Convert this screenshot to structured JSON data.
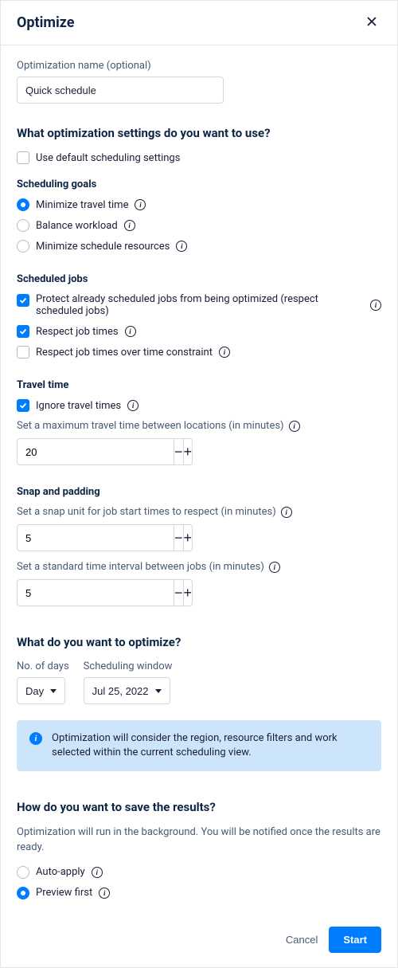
{
  "header": {
    "title": "Optimize"
  },
  "name_field": {
    "label": "Optimization name (optional)",
    "value": "Quick schedule"
  },
  "settings_section": {
    "title": "What optimization settings do you want to use?",
    "use_default_label": "Use default scheduling settings"
  },
  "goals": {
    "title": "Scheduling goals",
    "minimize_travel": "Minimize travel time",
    "balance_workload": "Balance workload",
    "minimize_resources": "Minimize schedule resources"
  },
  "scheduled_jobs": {
    "title": "Scheduled jobs",
    "protect": "Protect already scheduled jobs from being optimized (respect scheduled jobs)",
    "respect_times": "Respect job times",
    "respect_over_constraint": "Respect job times over time constraint"
  },
  "travel": {
    "title": "Travel time",
    "ignore": "Ignore travel times",
    "max_label": "Set a maximum travel time between locations (in minutes)",
    "max_value": "20"
  },
  "snap": {
    "title": "Snap and padding",
    "unit_label": "Set a snap unit for job start times to respect (in minutes)",
    "unit_value": "5",
    "interval_label": "Set a standard time interval between jobs (in minutes)",
    "interval_value": "5"
  },
  "what_optimize": {
    "title": "What do you want to optimize?",
    "days_label": "No. of days",
    "days_value": "Day",
    "window_label": "Scheduling window",
    "window_value": "Jul 25, 2022",
    "banner": "Optimization will consider the region, resource filters and work selected within the current scheduling view."
  },
  "save_results": {
    "title": "How do you want to save the results?",
    "helper": "Optimization will run in the background. You will be notified once the results are ready.",
    "auto_apply": "Auto-apply",
    "preview_first": "Preview first"
  },
  "footer": {
    "cancel": "Cancel",
    "start": "Start"
  }
}
